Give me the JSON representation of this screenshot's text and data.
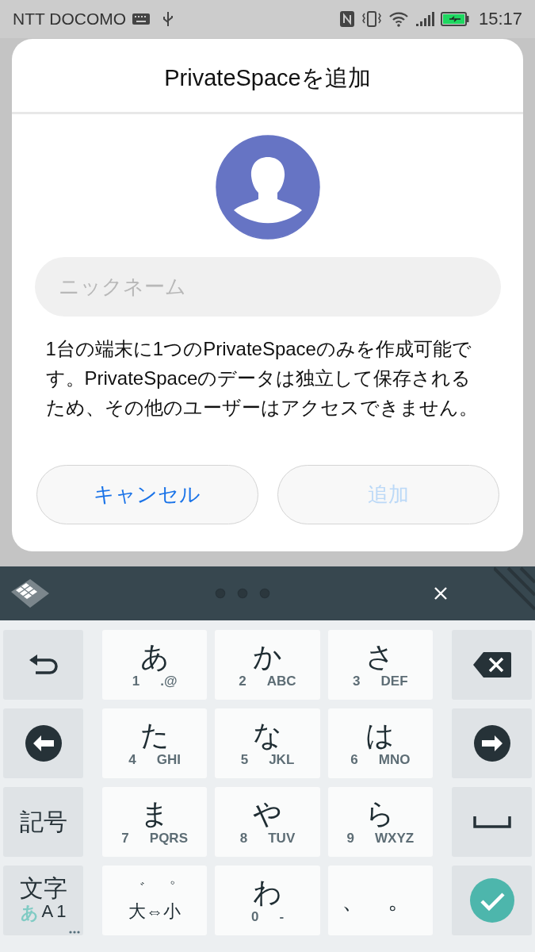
{
  "status_bar": {
    "carrier": "NTT DOCOMO",
    "time": "15:17"
  },
  "dialog": {
    "title": "PrivateSpaceを追加",
    "nickname_field": {
      "placeholder": "ニックネーム"
    },
    "message": "1台の端末に1つのPrivateSpaceのみを作成可能です。PrivateSpaceのデータは独立して保存されるため、その他のユーザーはアクセスできません。",
    "buttons": [
      {
        "label": "キャンセル",
        "disabled": false
      },
      {
        "label": "追加",
        "disabled": true
      }
    ]
  },
  "keyboard": {
    "symbol_key": "記号",
    "mode_key": {
      "label": "文字",
      "modes": [
        {
          "label": "あ",
          "selected": true
        },
        {
          "label": "A",
          "selected": false
        },
        {
          "label": "1",
          "selected": false
        }
      ]
    },
    "keys": [
      {
        "kind": "kana",
        "main": "あ",
        "num": "1",
        "letters": ".@"
      },
      {
        "kind": "kana",
        "main": "か",
        "num": "2",
        "letters": "ABC"
      },
      {
        "kind": "kana",
        "main": "さ",
        "num": "3",
        "letters": "DEF"
      },
      {
        "kind": "kana",
        "main": "た",
        "num": "4",
        "letters": "GHI"
      },
      {
        "kind": "kana",
        "main": "な",
        "num": "5",
        "letters": "JKL"
      },
      {
        "kind": "kana",
        "main": "は",
        "num": "6",
        "letters": "MNO"
      },
      {
        "kind": "kana",
        "main": "ま",
        "num": "7",
        "letters": "PQRS"
      },
      {
        "kind": "kana",
        "main": "や",
        "num": "8",
        "letters": "TUV"
      },
      {
        "kind": "kana",
        "main": "ら",
        "num": "9",
        "letters": "WXYZ"
      },
      {
        "kind": "dakuten",
        "top": "゛ ゜",
        "bottom": "大⇔小"
      },
      {
        "kind": "kana",
        "main": "わ",
        "num": "0",
        "letters": "-"
      },
      {
        "kind": "punct",
        "label": "、 。"
      }
    ]
  }
}
